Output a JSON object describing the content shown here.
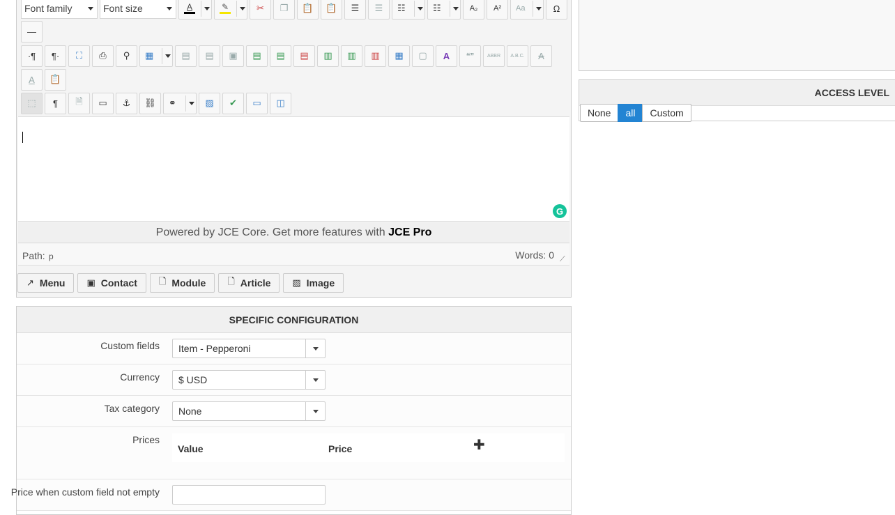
{
  "editor": {
    "toolbar": {
      "font_family": "Font family",
      "font_size": "Font size",
      "row1_icons": [
        "text-color-icon",
        "highlight-icon",
        "cut-icon",
        "copy-icon",
        "paste-icon",
        "paste-text-icon",
        "indent-icon",
        "outdent-icon",
        "numbered-list-icon",
        "bullet-list-icon",
        "subscript-icon",
        "superscript-icon",
        "style-icon",
        "special-char-icon"
      ],
      "row2_icons": [
        "horizontal-rule-icon"
      ],
      "row3_icons": [
        "ltr-icon",
        "rtl-icon",
        "fullscreen-icon",
        "print-icon",
        "search-replace-icon",
        "table-icon",
        "delete-table-icon",
        "row-props-icon",
        "cell-props-icon",
        "insert-row-before-icon",
        "insert-row-after-icon",
        "delete-row-icon",
        "insert-col-before-icon",
        "insert-col-after-icon",
        "delete-col-icon",
        "merge-cells-icon",
        "split-cells-icon",
        "style-props-icon",
        "blockquote-icon",
        "abbr-icon",
        "acronym-icon",
        "strikethrough-icon"
      ],
      "row4_icons": [
        "text-case-icon",
        "paste-word-icon"
      ],
      "row5_icons": [
        "visual-aid-icon",
        "visual-chars-icon",
        "template-icon",
        "form-icon",
        "anchor-icon",
        "unlink-icon",
        "link-icon",
        "image-icon",
        "spellcheck-icon",
        "read-more-icon",
        "page-break-icon"
      ],
      "glyphs": {
        "bold_a": "A",
        "pilcrow": "¶",
        "quote": "❝❞",
        "abbr": "ABBR",
        "abc": "A.B.C.",
        "strike": "A",
        "subscript": "A₂",
        "superscript": "A²",
        "omega": "Ω",
        "hr": "—"
      }
    },
    "powered_text": "Powered by JCE Core. Get more features with ",
    "powered_pro": "JCE Pro",
    "path_label": "Path:",
    "path_value": "p",
    "words": "Words: 0",
    "grammarly_label": "G",
    "insert_buttons": [
      {
        "label": "Menu",
        "icon": "menu-icon"
      },
      {
        "label": "Contact",
        "icon": "contact-icon"
      },
      {
        "label": "Module",
        "icon": "module-icon"
      },
      {
        "label": "Article",
        "icon": "article-icon"
      },
      {
        "label": "Image",
        "icon": "image-icon"
      }
    ]
  },
  "specific": {
    "title": "SPECIFIC CONFIGURATION",
    "custom_fields_label": "Custom fields",
    "custom_fields_value": "Item - Pepperoni",
    "currency_label": "Currency",
    "currency_value": "$ USD",
    "tax_label": "Tax category",
    "tax_value": "None",
    "prices_label": "Prices",
    "prices_col_value": "Value",
    "prices_col_price": "Price",
    "add_symbol": "✚",
    "price_nonempty_label": "Price when custom field not empty"
  },
  "access": {
    "title": "ACCESS LEVEL",
    "options": [
      "None",
      "all",
      "Custom"
    ],
    "selected": "all"
  }
}
